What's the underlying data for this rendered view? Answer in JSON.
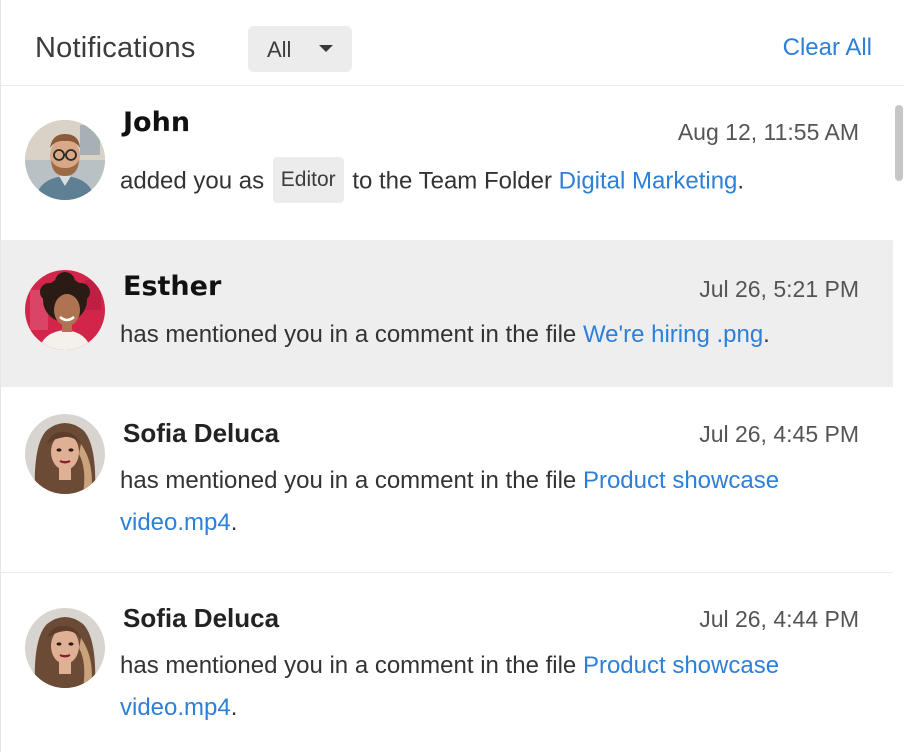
{
  "header": {
    "title": "Notifications",
    "filter": {
      "selected": "All"
    },
    "clear_all_label": "Clear All"
  },
  "notifications": [
    {
      "name": "John",
      "time": "Aug 12, 11:55 AM",
      "text_before": "added you as ",
      "badge": "Editor",
      "text_middle": " to the Team Folder ",
      "link": "Digital Marketing",
      "text_after": ".",
      "avatar": "man-glasses-beard-avatar",
      "active": false
    },
    {
      "name": "Esther",
      "time": "Jul 26, 5:21 PM",
      "text_before": "has mentioned you in a comment in the file ",
      "link": "We're hiring .png",
      "text_after": ".",
      "avatar": "woman-curly-hair-avatar",
      "active": true
    },
    {
      "name": "Sofia Deluca",
      "time": "Jul 26, 4:45 PM",
      "text_before": "has mentioned you in a comment in the file ",
      "link": "Product showcase video.mp4",
      "text_after": ".",
      "avatar": "woman-long-hair-avatar",
      "active": false
    },
    {
      "name": "Sofia Deluca",
      "time": "Jul 26, 4:44 PM",
      "text_before": "has mentioned you in a comment in the file ",
      "link": "Product showcase video.mp4",
      "text_after": ".",
      "avatar": "woman-long-hair-avatar",
      "active": false
    }
  ],
  "colors": {
    "link": "#2d7fd8",
    "active_row": "#eeeeee",
    "badge_bg": "#ececec"
  }
}
